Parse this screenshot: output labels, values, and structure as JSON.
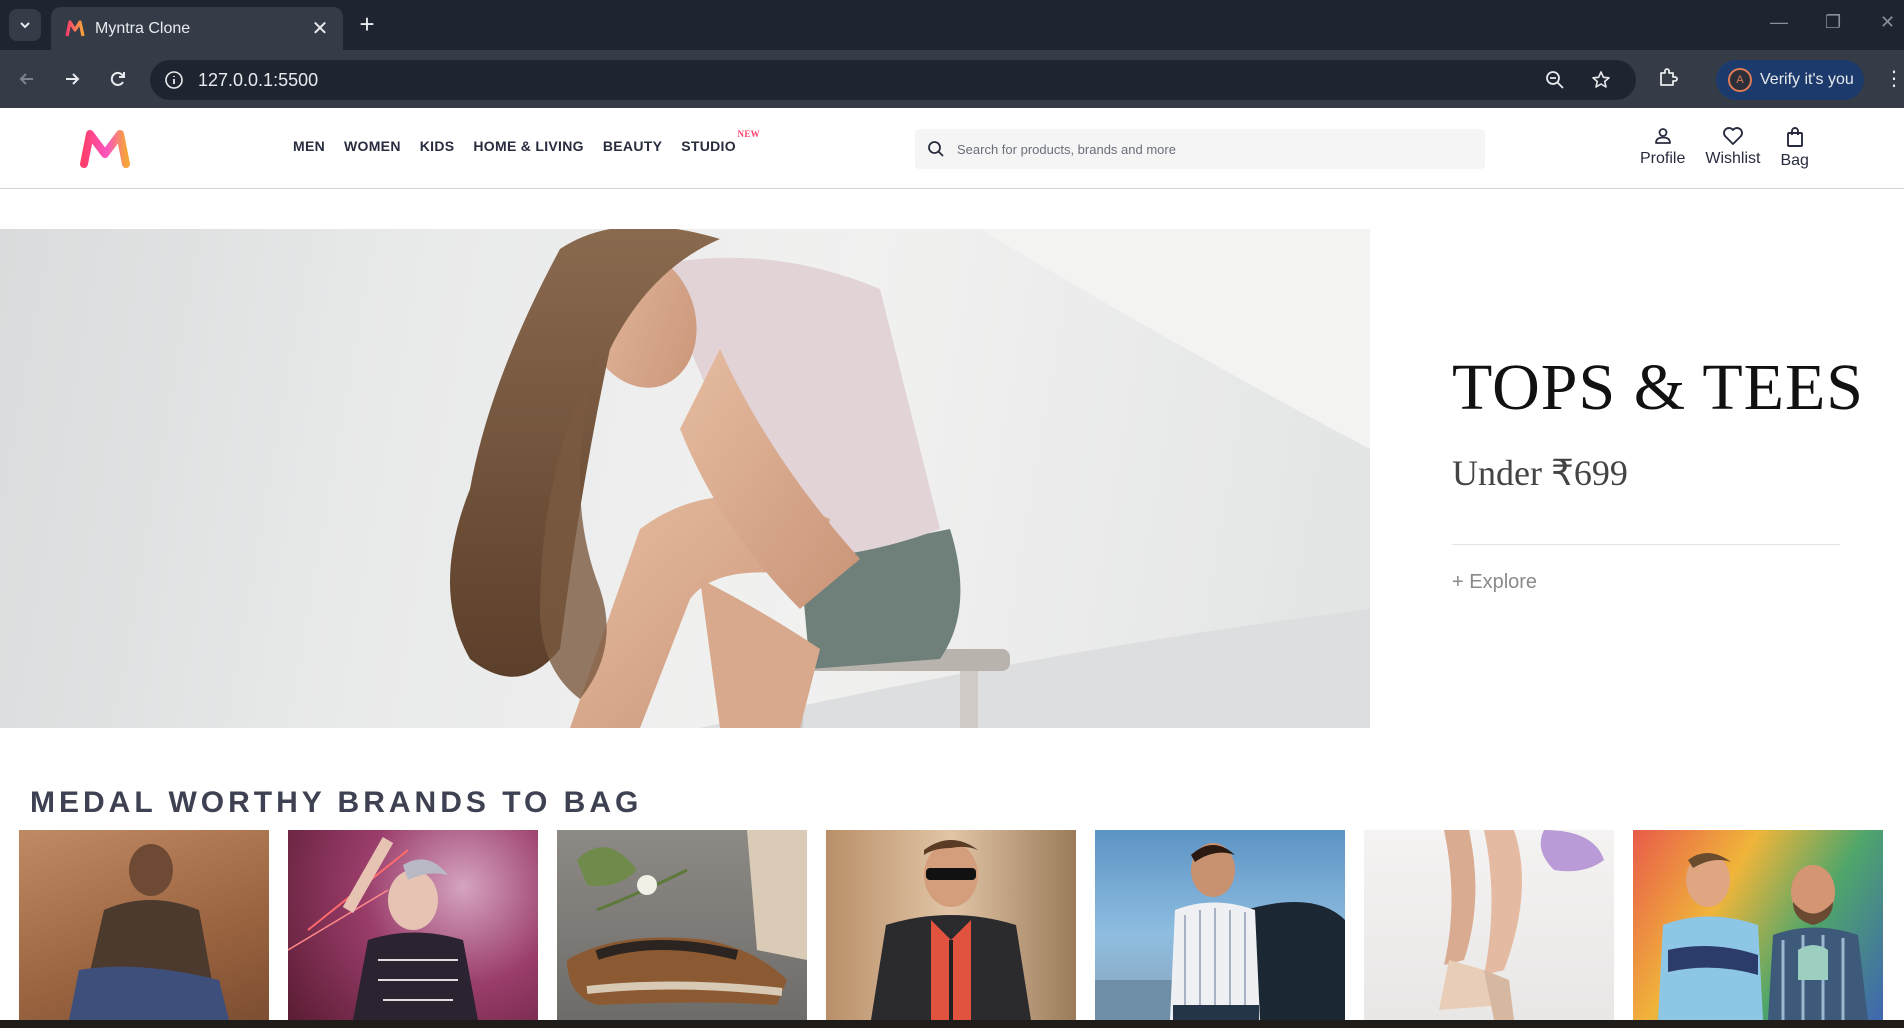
{
  "browser": {
    "tab_title": "Myntra Clone",
    "url": "127.0.0.1:5500",
    "verify_label": "Verify it's you",
    "avatar_letter": "A"
  },
  "site": {
    "nav": [
      {
        "label": "MEN"
      },
      {
        "label": "WOMEN"
      },
      {
        "label": "KIDS"
      },
      {
        "label": "HOME & LIVING"
      },
      {
        "label": "BEAUTY"
      },
      {
        "label": "STUDIO",
        "badge": "NEW"
      }
    ],
    "search": {
      "placeholder": "Search for products, brands and more"
    },
    "actions": [
      {
        "label": "Profile",
        "icon": "user-icon"
      },
      {
        "label": "Wishlist",
        "icon": "heart-icon"
      },
      {
        "label": "Bag",
        "icon": "bag-icon"
      }
    ]
  },
  "hero": {
    "title": "TOPS & TEES",
    "subtitle": "Under ₹699",
    "cta": "+ Explore"
  },
  "brands_section": {
    "title": "MEDAL WORTHY BRANDS TO BAG",
    "cards": [
      {
        "name": "brand-card-1"
      },
      {
        "name": "brand-card-2"
      },
      {
        "name": "brand-card-3"
      },
      {
        "name": "brand-card-4"
      },
      {
        "name": "brand-card-5"
      },
      {
        "name": "brand-card-6"
      },
      {
        "name": "brand-card-7"
      }
    ]
  },
  "colors": {
    "accent": "#ff3f6c",
    "text": "#282c3f",
    "chrome_bg": "#1f2530",
    "chrome_toolbar": "#353c48"
  }
}
